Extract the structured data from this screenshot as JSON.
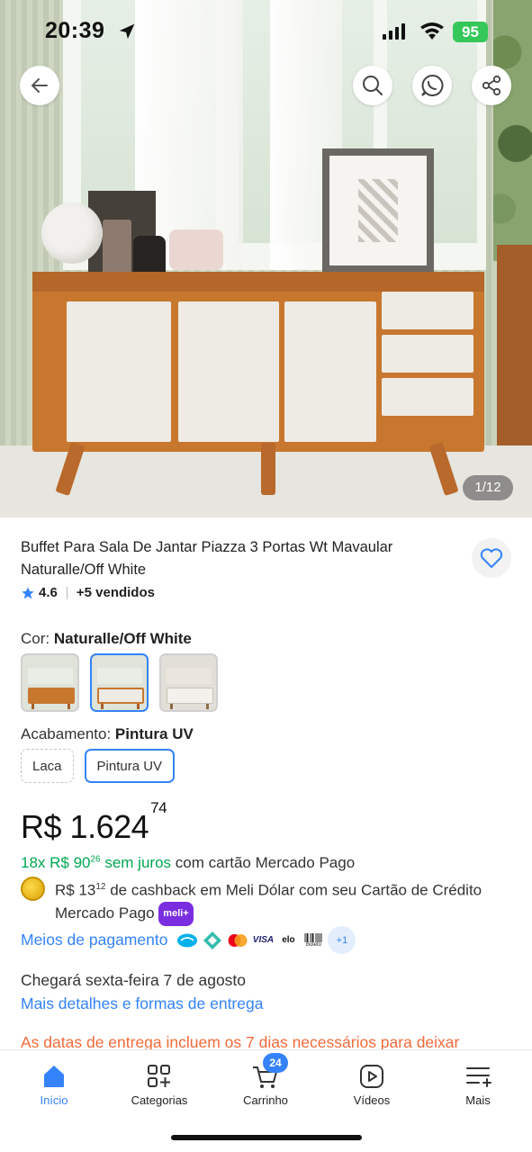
{
  "status_bar": {
    "time": "20:39",
    "battery": "95"
  },
  "gallery": {
    "counter": "1/12"
  },
  "product": {
    "title": "Buffet Para Sala De Jantar Piazza 3 Portas Wt Mavaular Naturalle/Off White",
    "rating": "4.6",
    "sold": "+5 vendidos"
  },
  "color": {
    "label": "Cor:",
    "value": "Naturalle/Off White",
    "options_count": 3,
    "selected_index": 1
  },
  "finish": {
    "label": "Acabamento:",
    "value": "Pintura UV",
    "options": [
      "Laca",
      "Pintura UV"
    ]
  },
  "price": {
    "currency": "R$",
    "integer": "1.624",
    "cents": "74"
  },
  "installments": {
    "green_count": "18x R$ 90",
    "green_cents": "26",
    "green_suffix": " sem juros",
    "rest": " com cartão Mercado Pago"
  },
  "cashback": {
    "amount": "R$ 13",
    "amount_cents": "12",
    "text": " de cashback em Meli Dólar com seu Cartão de Crédito Mercado Pago ",
    "badge": "meli+"
  },
  "payments": {
    "link": "Meios de pagamento",
    "methods": [
      "mercado-pago",
      "pix",
      "mastercard",
      "VISA",
      "elo",
      "Boleto"
    ],
    "more": "+1"
  },
  "delivery": {
    "text": "Chegará sexta-feira 7 de agosto",
    "link": "Mais detalhes e formas de entrega",
    "warning": "As datas de entrega incluem os 7 dias necessários para deixar"
  },
  "bottom_nav": {
    "items": [
      {
        "label": "Início",
        "icon": "home-icon"
      },
      {
        "label": "Categorias",
        "icon": "categories-icon"
      },
      {
        "label": "Carrinho",
        "icon": "cart-icon"
      },
      {
        "label": "Vídeos",
        "icon": "video-icon"
      },
      {
        "label": "Mais",
        "icon": "menu-plus-icon"
      }
    ],
    "cart_badge": "24",
    "active_index": 0
  },
  "colors": {
    "accent": "#3483fa",
    "green": "#00a650",
    "warning": "#f26b3a"
  }
}
